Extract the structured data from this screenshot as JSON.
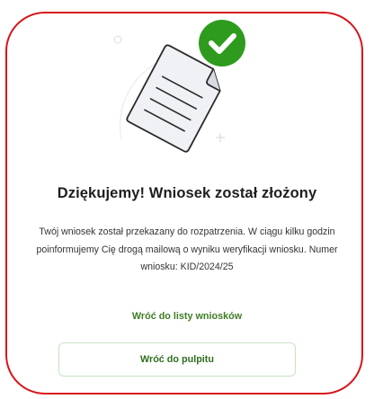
{
  "dialog": {
    "title": "Dziękujemy! Wniosek został złożony",
    "message": "Twój wniosek został przekazany do rozpatrzenia. W ciągu kilku godzin poinformujemy Cię drogą mailową o wyniku weryfikacji wniosku. Numer wniosku: KID/2024/25",
    "link_back_to_list": "Wróć do listy wniosków",
    "button_back_to_dashboard": "Wróć do pulpitu"
  },
  "colors": {
    "border": "#d7141a",
    "success": "#2e9b1e",
    "link": "#3d7d25"
  },
  "icons": {
    "document": "document-icon",
    "check": "check-circle-icon"
  }
}
